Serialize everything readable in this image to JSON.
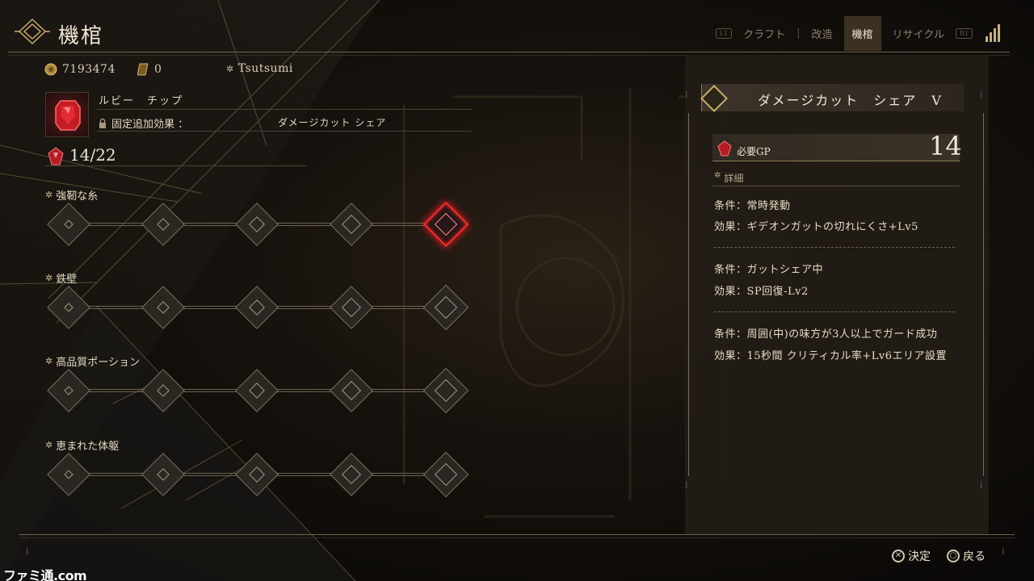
{
  "header": {
    "title": "機棺",
    "nav": {
      "left_tag": "L1",
      "right_tag": "R1",
      "tabs": [
        "クラフト",
        "改造",
        "機棺",
        "リサイクル"
      ],
      "active_tab": "機棺"
    }
  },
  "status": {
    "gold": "7193474",
    "tickets": "0",
    "player_name": "Tsutsumi"
  },
  "chip": {
    "name": "ルビー　チップ",
    "fixed_effect_label": "固定追加効果 ：",
    "fixed_effect_value": "ダメージカット シェア",
    "gp": "14/22"
  },
  "skill_rows": [
    {
      "title": "強靭な糸"
    },
    {
      "title": "鉄壁"
    },
    {
      "title": "高品質ポーション"
    },
    {
      "title": "恵まれた体躯"
    }
  ],
  "selected_node": {
    "row": 0,
    "index": 4
  },
  "detail_panel": {
    "title": "ダメージカット　シェア　V",
    "gp_label": "必要GP",
    "gp_value": "14",
    "detail_label": "詳細",
    "entries": [
      {
        "condition": "条件：常時発動",
        "effect": "効果：ギデオンガットの切れにくさ+Lv5"
      },
      {
        "condition": "条件：ガットシェア中",
        "effect": "効果：SP回復-Lv2"
      },
      {
        "condition": "条件：周囲(中)の味方が3人以上でガード成功",
        "effect": "効果：15秒間 クリティカル率+Lv6エリア設置"
      }
    ]
  },
  "footer": {
    "confirm_label": "決定",
    "back_label": "戻る",
    "confirm_glyph": "✕",
    "back_glyph": "○",
    "watermark": "ファミ通.com"
  },
  "colors": {
    "accent_gold": "#c9ad6b",
    "selected_red": "#ff2a2a",
    "panel_bg": "#211c16"
  }
}
